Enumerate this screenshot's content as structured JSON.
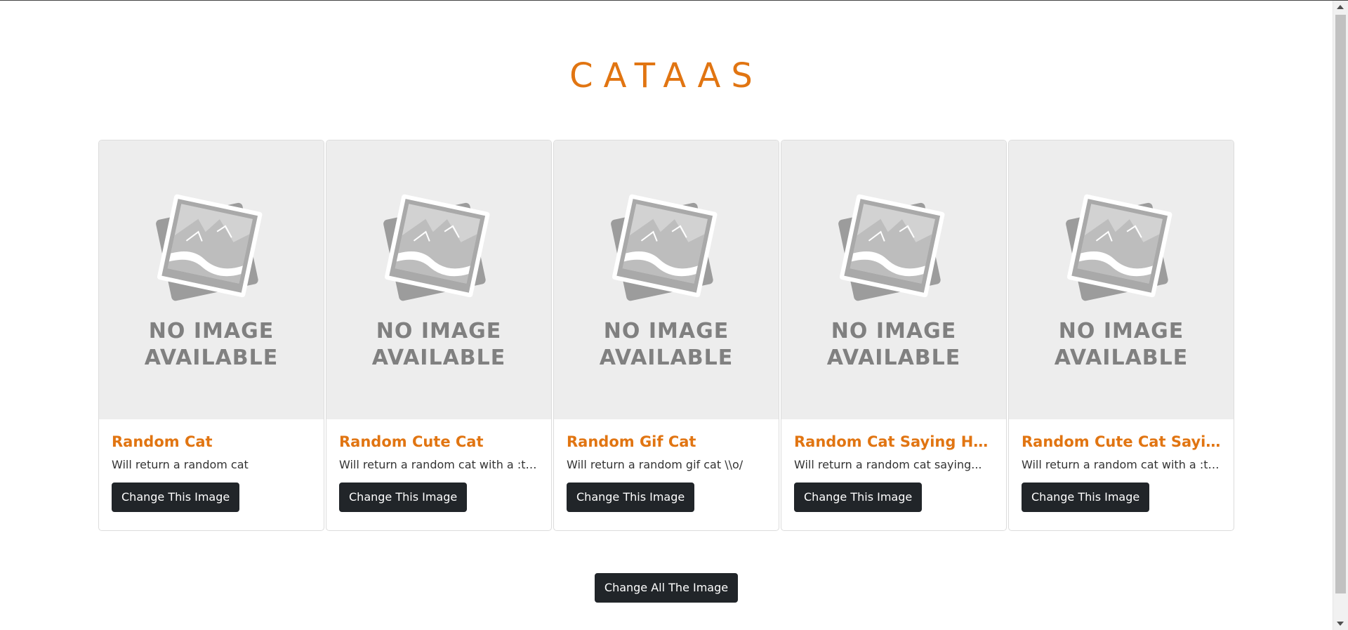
{
  "header": {
    "title": "CATAAS"
  },
  "placeholder": {
    "line1": "NO IMAGE",
    "line2": "AVAILABLE"
  },
  "cards": [
    {
      "title": "Random Cat",
      "text": "Will return a random cat",
      "button": "Change This Image"
    },
    {
      "title": "Random Cute Cat",
      "text": "Will return a random cat with a :tag",
      "button": "Change This Image"
    },
    {
      "title": "Random Gif Cat",
      "text": "Will return a random gif cat \\\\o/",
      "button": "Change This Image"
    },
    {
      "title": "Random Cat Saying Hello",
      "text": "Will return a random cat saying...",
      "button": "Change This Image"
    },
    {
      "title": "Random Cute Cat Saying...",
      "text": "Will return a random cat with a :ta...",
      "button": "Change This Image"
    }
  ],
  "footer": {
    "change_all_label": "Change All The Image"
  },
  "colors": {
    "accent": "#e17512",
    "button_bg": "#212529",
    "placeholder_bg": "#ededed"
  }
}
